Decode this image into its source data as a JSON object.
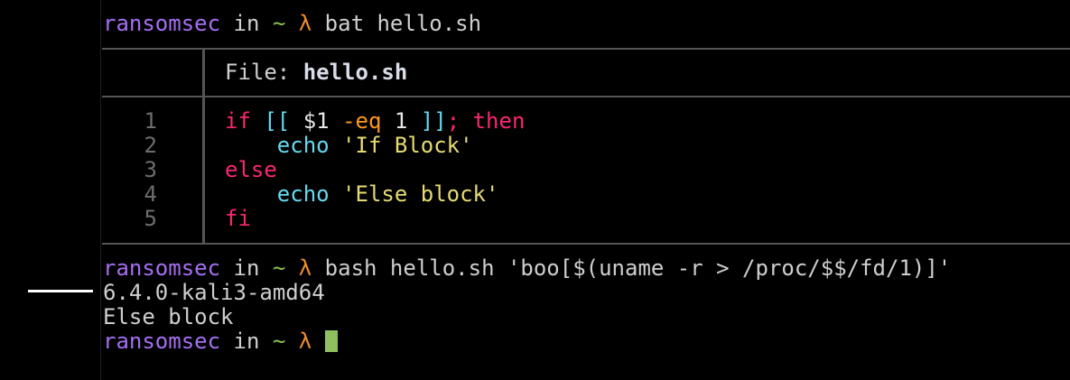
{
  "prompt": {
    "user": "ransomsec",
    "in": "in",
    "dir": "~",
    "symbol": "λ"
  },
  "commands": {
    "first": "bat hello.sh",
    "second": "bash hello.sh 'boo[$(uname -r > /proc/$$/fd/1)]'"
  },
  "bat": {
    "file_label": "File: ",
    "file_name": "hello.sh",
    "line_numbers": [
      "1",
      "2",
      "3",
      "4",
      "5"
    ],
    "code": {
      "l1_if": "if",
      "l1_open": "[[",
      "l1_var": "$1",
      "l1_op": "-eq",
      "l1_num": "1",
      "l1_close": "]]",
      "l1_semi": ";",
      "l1_then": "then",
      "l2_echo": "echo",
      "l2_str": "'If Block'",
      "l3_else": "else",
      "l4_echo": "echo",
      "l4_str": "'Else block'",
      "l5_fi": "fi"
    }
  },
  "output": {
    "line1": "6.4.0-kali3-amd64",
    "line2": "Else block"
  },
  "colors": {
    "user": "#a46ff0",
    "tilde": "#8bc34a",
    "lambda": "#f08c2e",
    "keyword": "#f92672",
    "builtin": "#66d9ef",
    "string": "#e6db74",
    "cursor": "#8fbf5f"
  }
}
